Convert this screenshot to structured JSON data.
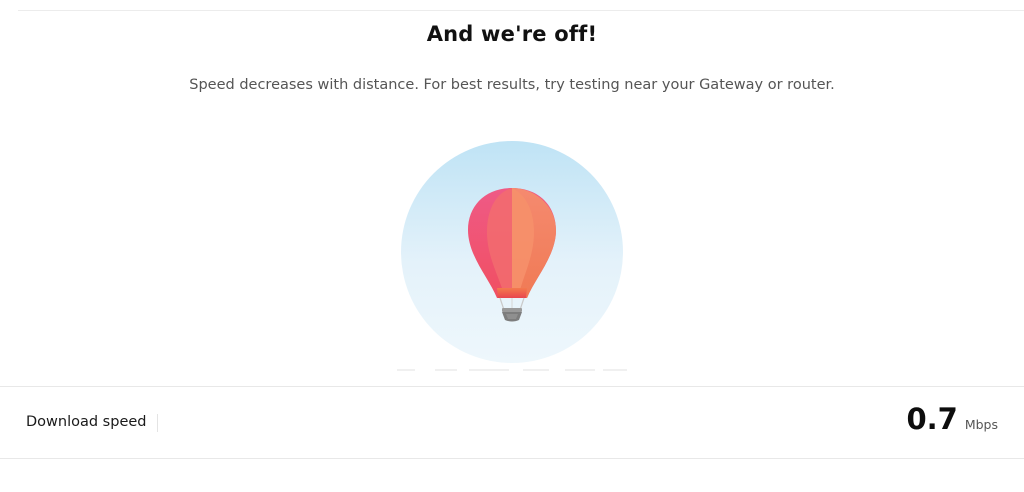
{
  "header": {
    "title": "And we're off!",
    "subtitle": "Speed decreases with distance. For best results, try testing near your Gateway or router."
  },
  "illustration": {
    "icon": "hot-air-balloon-icon",
    "sky_colors": [
      "#bfe3f5",
      "#eef7fc"
    ],
    "balloon_colors": [
      "#f0577f",
      "#f5886a",
      "#e9464f"
    ]
  },
  "result": {
    "label": "Download speed",
    "value": "0.7",
    "unit": "Mbps"
  }
}
